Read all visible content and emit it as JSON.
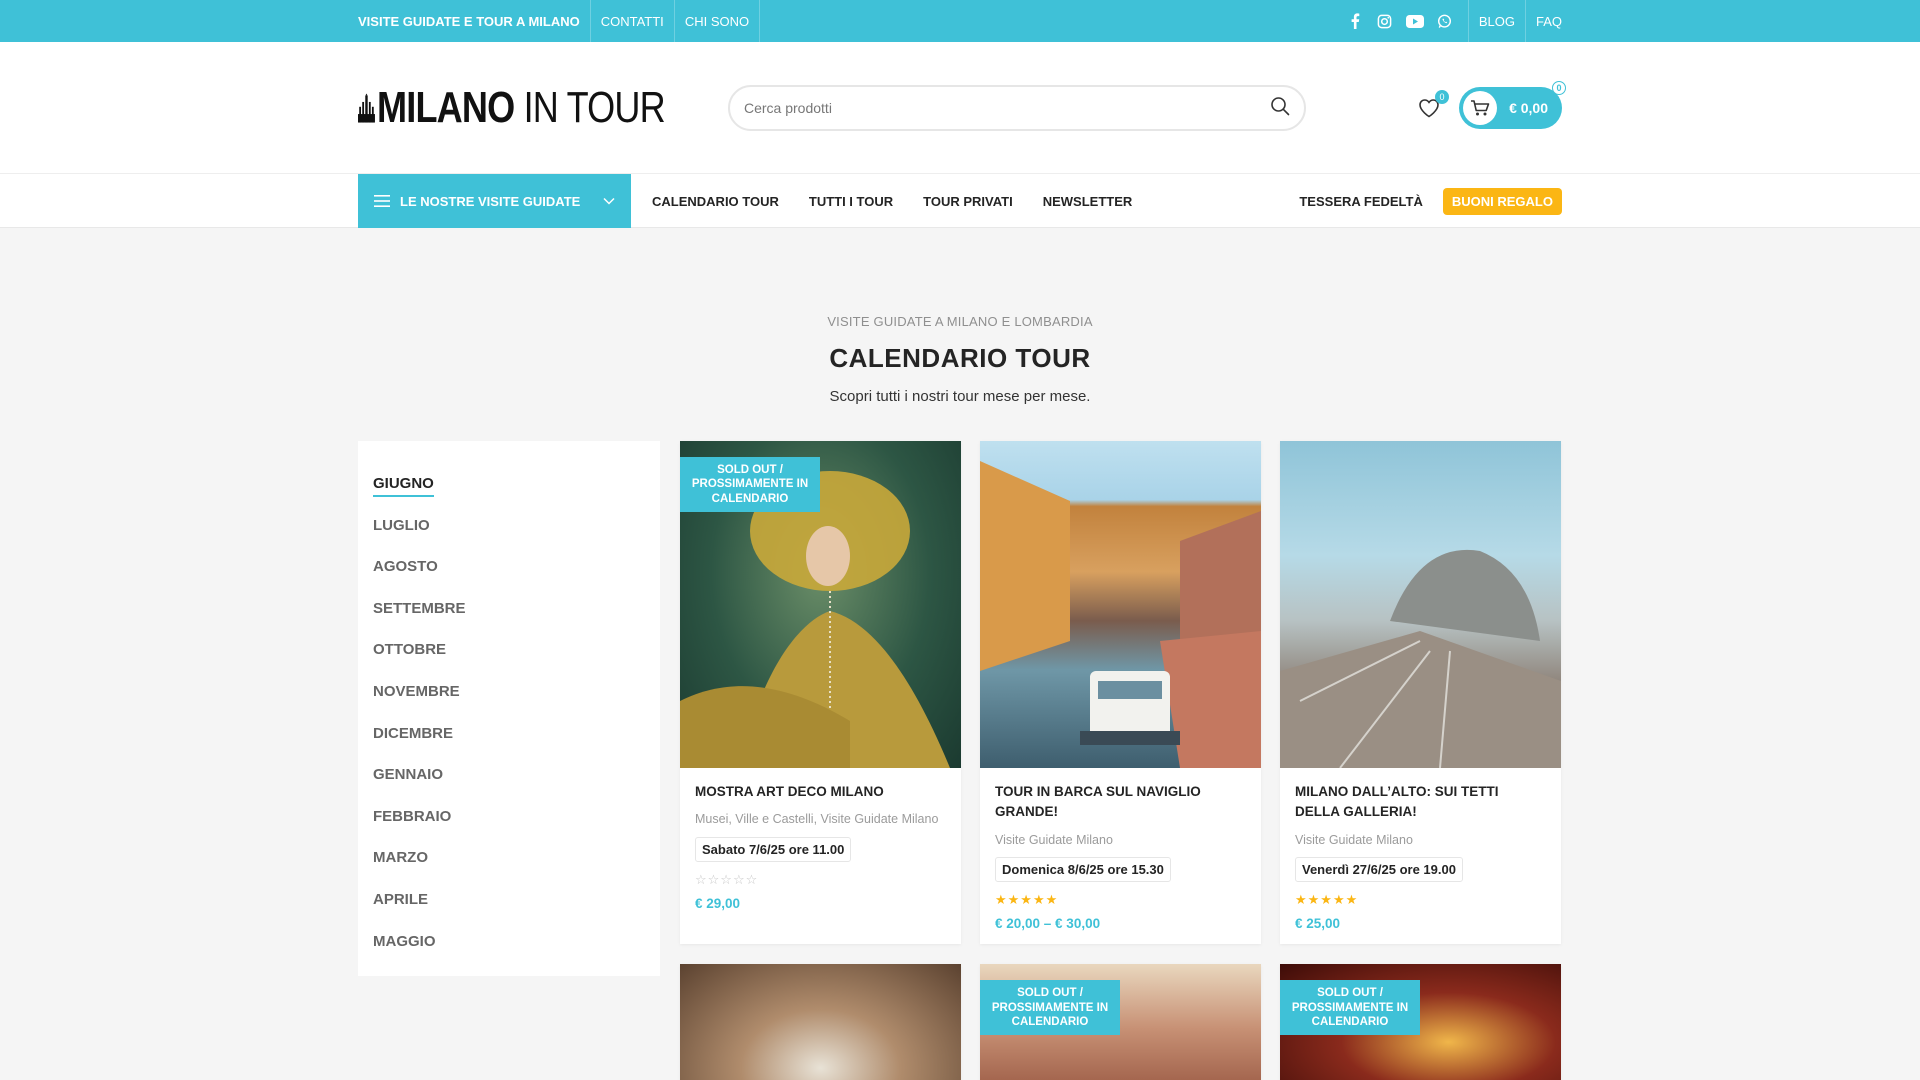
{
  "topbar": {
    "links_left": [
      "VISITE GUIDATE E TOUR A MILANO",
      "CONTATTI",
      "CHI SONO"
    ],
    "links_right": [
      "BLOG",
      "FAQ"
    ],
    "socials": [
      "facebook-icon",
      "instagram-icon",
      "youtube-icon",
      "whatsapp-icon"
    ]
  },
  "header": {
    "logo_bold": "MILANO",
    "logo_light": " IN TOUR",
    "search_placeholder": "Cerca prodotti",
    "wishlist_count": "0",
    "cart_total": "€ 0,00",
    "cart_count": "0"
  },
  "nav": {
    "categories_label": "LE NOSTRE VISITE GUIDATE",
    "menu": [
      "CALENDARIO TOUR",
      "TUTTI I TOUR",
      "TOUR PRIVATI",
      "NEWSLETTER"
    ],
    "loyalty": "TESSERA FEDELTÀ",
    "gift": "BUONI REGALO"
  },
  "hero": {
    "subtitle": "VISITE GUIDATE A MILANO E LOMBARDIA",
    "title": "CALENDARIO TOUR",
    "description": "Scopri tutti i nostri tour mese per mese."
  },
  "months": [
    "GIUGNO",
    "LUGLIO",
    "AGOSTO",
    "SETTEMBRE",
    "OTTOBRE",
    "NOVEMBRE",
    "DICEMBRE",
    "GENNAIO",
    "FEBBRAIO",
    "MARZO",
    "APRILE",
    "MAGGIO"
  ],
  "products": [
    {
      "tag": "SOLD OUT / PROSSIMAMENTE IN CALENDARIO",
      "title": "MOSTRA ART DECO MILANO",
      "category": "Musei, Ville e Castelli, Visite Guidate Milano",
      "date": "Sabato 7/6/25 ore 11.00",
      "stars": "☆☆☆☆☆",
      "price": "€ 29,00"
    },
    {
      "tag": "",
      "title": "TOUR IN BARCA SUL NAVIGLIO GRANDE!",
      "category": "Visite Guidate Milano",
      "date": "Domenica 8/6/25 ore 15.30",
      "stars": "★★★★★",
      "price": "€ 20,00 – € 30,00"
    },
    {
      "tag": "",
      "title": "MILANO DALL’ALTO: SUI TETTI DELLA GALLERIA!",
      "category": "Visite Guidate Milano",
      "date": "Venerdì 27/6/25 ore 19.00",
      "stars": "★★★★★",
      "price": "€ 25,00"
    },
    {
      "tag": ""
    },
    {
      "tag": "SOLD OUT / PROSSIMAMENTE IN CALENDARIO"
    },
    {
      "tag": "SOLD OUT / PROSSIMAMENTE IN CALENDARIO"
    }
  ],
  "colors": {
    "accent": "#3fc1d7",
    "gift": "#fbb614"
  }
}
